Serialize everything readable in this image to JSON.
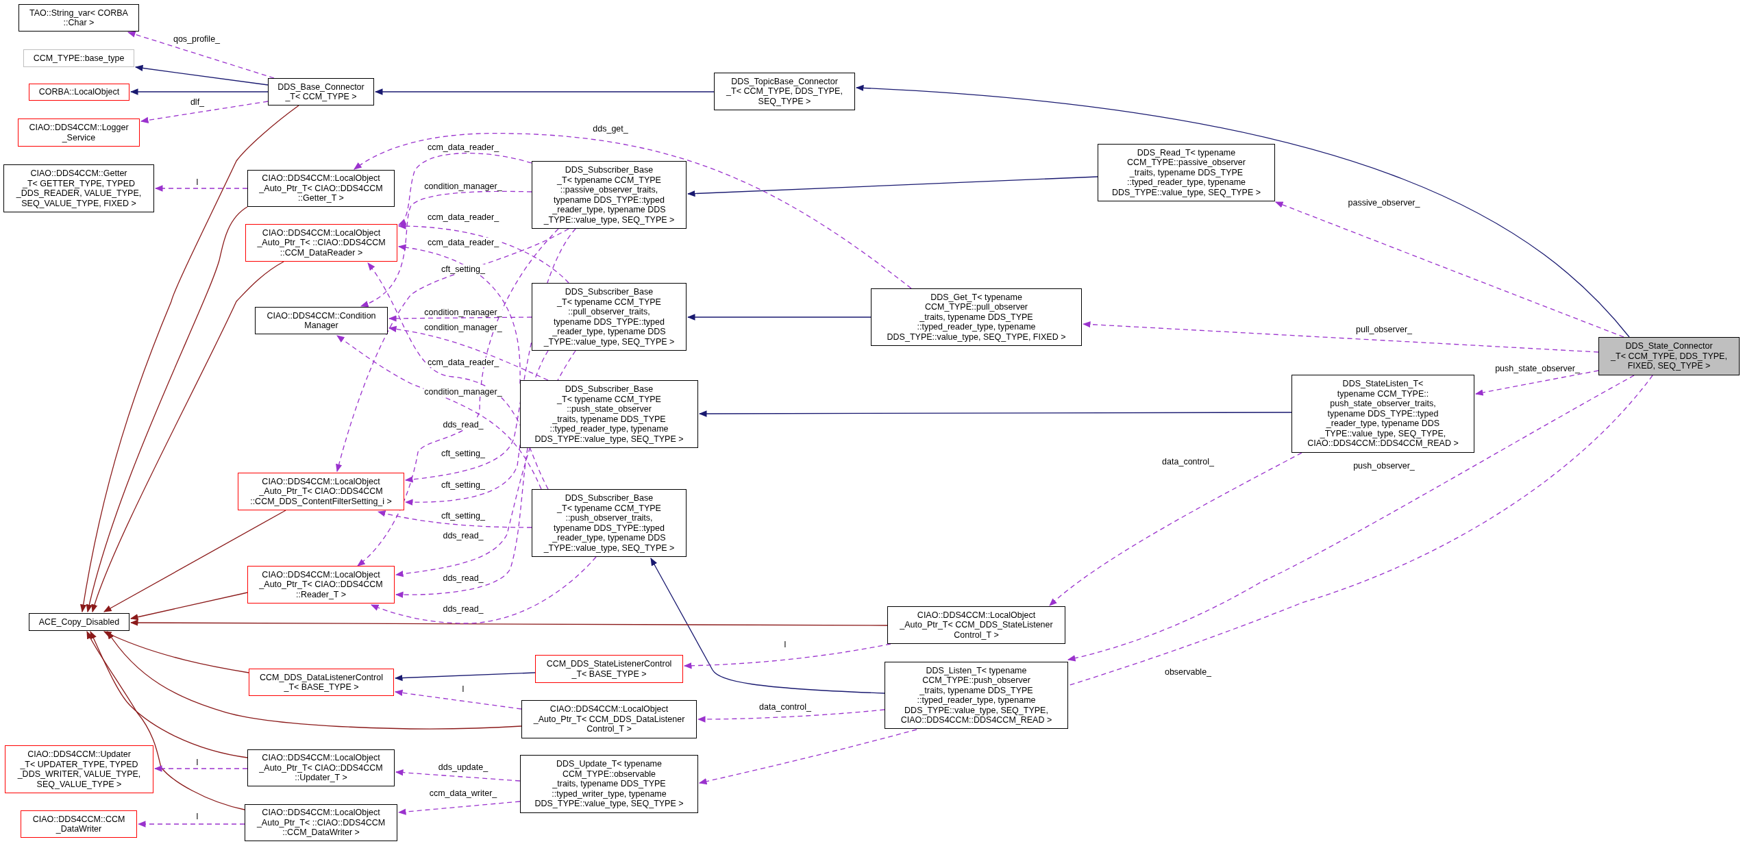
{
  "nodes": [
    {
      "lines": [
        "TAO::String_var< CORBA",
        "::Char >"
      ],
      "color": "#000000",
      "highlighted": false
    },
    {
      "lines": [
        "CCM_TYPE::base_type"
      ],
      "color": "#bfbfbf",
      "highlighted": false
    },
    {
      "lines": [
        "CORBA::LocalObject"
      ],
      "color": "#ff0000",
      "highlighted": false
    },
    {
      "lines": [
        "CIAO::DDS4CCM::Logger",
        "_Service"
      ],
      "color": "#ff0000",
      "highlighted": false
    },
    {
      "lines": [
        "CIAO::DDS4CCM::Getter",
        "_T< GETTER_TYPE, TYPED",
        "_DDS_READER, VALUE_TYPE,",
        "SEQ_VALUE_TYPE, FIXED >"
      ],
      "color": "#000000",
      "highlighted": false
    },
    {
      "lines": [
        "DDS_Base_Connector",
        "_T< CCM_TYPE >"
      ],
      "color": "#000000",
      "highlighted": false
    },
    {
      "lines": [
        "CIAO::DDS4CCM::LocalObject",
        "_Auto_Ptr_T< CIAO::DDS4CCM",
        "::Getter_T >"
      ],
      "color": "#000000",
      "highlighted": false
    },
    {
      "lines": [
        "CIAO::DDS4CCM::LocalObject",
        "_Auto_Ptr_T< ::CIAO::DDS4CCM",
        "::CCM_DataReader >"
      ],
      "color": "#ff0000",
      "highlighted": false
    },
    {
      "lines": [
        "CIAO::DDS4CCM::Condition",
        "Manager"
      ],
      "color": "#000000",
      "highlighted": false
    },
    {
      "lines": [
        "CIAO::DDS4CCM::LocalObject",
        "_Auto_Ptr_T< CIAO::DDS4CCM",
        "::CCM_DDS_ContentFilterSetting_i >"
      ],
      "color": "#ff0000",
      "highlighted": false
    },
    {
      "lines": [
        "CIAO::DDS4CCM::LocalObject",
        "_Auto_Ptr_T< CIAO::DDS4CCM",
        "::Reader_T >"
      ],
      "color": "#ff0000",
      "highlighted": false
    },
    {
      "lines": [
        "ACE_Copy_Disabled"
      ],
      "color": "#000000",
      "highlighted": false
    },
    {
      "lines": [
        "CCM_DDS_DataListenerControl",
        "_T< BASE_TYPE >"
      ],
      "color": "#ff0000",
      "highlighted": false
    },
    {
      "lines": [
        "CIAO::DDS4CCM::Updater",
        "_T< UPDATER_TYPE, TYPED",
        "_DDS_WRITER, VALUE_TYPE,",
        "SEQ_VALUE_TYPE >"
      ],
      "color": "#ff0000",
      "highlighted": false
    },
    {
      "lines": [
        "CIAO::DDS4CCM::LocalObject",
        "_Auto_Ptr_T< CIAO::DDS4CCM",
        "::Updater_T >"
      ],
      "color": "#000000",
      "highlighted": false
    },
    {
      "lines": [
        "CIAO::DDS4CCM::CCM",
        "_DataWriter"
      ],
      "color": "#ff0000",
      "highlighted": false
    },
    {
      "lines": [
        "CIAO::DDS4CCM::LocalObject",
        "_Auto_Ptr_T< ::CIAO::DDS4CCM",
        "::CCM_DataWriter >"
      ],
      "color": "#000000",
      "highlighted": false
    },
    {
      "lines": [
        "DDS_TopicBase_Connector",
        "_T< CCM_TYPE, DDS_TYPE,",
        "SEQ_TYPE >"
      ],
      "color": "#000000",
      "highlighted": false
    },
    {
      "lines": [
        "DDS_Subscriber_Base",
        "_T< typename CCM_TYPE",
        "::passive_observer_traits,",
        "typename DDS_TYPE::typed",
        "_reader_type, typename DDS",
        "_TYPE::value_type, SEQ_TYPE >"
      ],
      "color": "#000000",
      "highlighted": false
    },
    {
      "lines": [
        "DDS_Subscriber_Base",
        "_T< typename CCM_TYPE",
        "::pull_observer_traits,",
        "typename DDS_TYPE::typed",
        "_reader_type, typename DDS",
        "_TYPE::value_type, SEQ_TYPE >"
      ],
      "color": "#000000",
      "highlighted": false
    },
    {
      "lines": [
        "DDS_Get_T< typename",
        "CCM_TYPE::pull_observer",
        "_traits, typename DDS_TYPE",
        "::typed_reader_type, typename",
        "DDS_TYPE::value_type, SEQ_TYPE, FIXED >"
      ],
      "color": "#000000",
      "highlighted": false
    },
    {
      "lines": [
        "DDS_Subscriber_Base",
        "_T< typename CCM_TYPE",
        "::push_state_observer",
        "_traits, typename DDS_TYPE",
        "::typed_reader_type, typename",
        "DDS_TYPE::value_type, SEQ_TYPE >"
      ],
      "color": "#000000",
      "highlighted": false
    },
    {
      "lines": [
        "DDS_Subscriber_Base",
        "_T< typename CCM_TYPE",
        "::push_observer_traits,",
        "typename DDS_TYPE::typed",
        "_reader_type, typename DDS",
        "_TYPE::value_type, SEQ_TYPE >"
      ],
      "color": "#000000",
      "highlighted": false
    },
    {
      "lines": [
        "CIAO::DDS4CCM::LocalObject",
        "_Auto_Ptr_T< CCM_DDS_StateListener",
        "Control_T >"
      ],
      "color": "#000000",
      "highlighted": false
    },
    {
      "lines": [
        "CCM_DDS_StateListenerControl",
        "_T< BASE_TYPE >"
      ],
      "color": "#ff0000",
      "highlighted": false
    },
    {
      "lines": [
        "CIAO::DDS4CCM::LocalObject",
        "_Auto_Ptr_T< CCM_DDS_DataListener",
        "Control_T >"
      ],
      "color": "#000000",
      "highlighted": false
    },
    {
      "lines": [
        "DDS_Listen_T< typename",
        "CCM_TYPE::push_observer",
        "_traits, typename DDS_TYPE",
        "::typed_reader_type, typename",
        "DDS_TYPE::value_type, SEQ_TYPE,",
        "CIAO::DDS4CCM::DDS4CCM_READ >"
      ],
      "color": "#000000",
      "highlighted": false
    },
    {
      "lines": [
        "DDS_Update_T< typename",
        "CCM_TYPE::observable",
        "_traits, typename DDS_TYPE",
        "::typed_writer_type, typename",
        "DDS_TYPE::value_type, SEQ_TYPE >"
      ],
      "color": "#000000",
      "highlighted": false
    },
    {
      "lines": [
        "DDS_Read_T< typename",
        "CCM_TYPE::passive_observer",
        "_traits, typename DDS_TYPE",
        "::typed_reader_type, typename",
        "DDS_TYPE::value_type, SEQ_TYPE >"
      ],
      "color": "#000000",
      "highlighted": false
    },
    {
      "lines": [
        "DDS_State_Connector",
        "_T< CCM_TYPE, DDS_TYPE,",
        "FIXED, SEQ_TYPE >"
      ],
      "color": "#000000",
      "highlighted": true
    },
    {
      "lines": [
        "DDS_StateListen_T<",
        "typename CCM_TYPE::",
        "push_state_observer_traits,",
        "typename DDS_TYPE::typed",
        "_reader_type, typename DDS",
        "_TYPE::value_type, SEQ_TYPE,",
        "CIAO::DDS4CCM::DDS4CCM_READ >"
      ],
      "color": "#000000",
      "highlighted": false
    }
  ],
  "edge_labels": [
    "qos_profile_",
    "dlf_",
    "l",
    "dds_get_",
    "ccm_data_reader_",
    "condition_manager_",
    "ccm_data_reader_",
    "passive_observer_",
    "ccm_data_reader_",
    "cft_setting_",
    "condition_manager_",
    "condition_manager_",
    "pull_observer_",
    "ccm_data_reader_",
    "push_state_observer_",
    "condition_manager_",
    "dds_read_",
    "cft_setting_",
    "data_control_",
    "push_observer_",
    "cft_setting_",
    "cft_setting_",
    "dds_read_",
    "dds_read_",
    "dds_read_",
    "l",
    "observable_",
    "l",
    "data_control_",
    "l",
    "dds_update_",
    "ccm_data_writer_",
    "l"
  ]
}
